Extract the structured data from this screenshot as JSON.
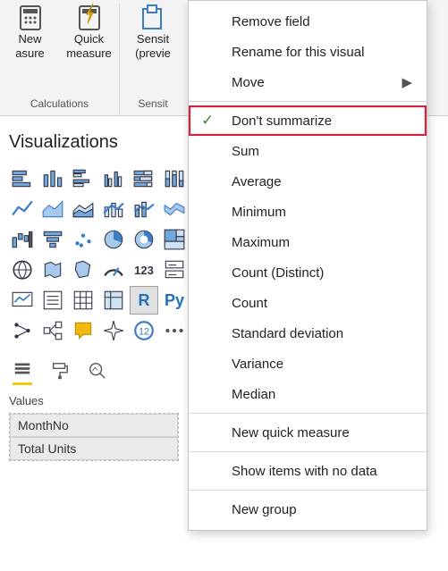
{
  "ribbon": {
    "group1_label": "Calculations",
    "group2_label": "Sensit",
    "btn_new_measure_l1": "New",
    "btn_new_measure_l2": "asure",
    "btn_quick_measure_l1": "Quick",
    "btn_quick_measure_l2": "measure",
    "btn_sensit_l1": "Sensit",
    "btn_sensit_l2": "(previe"
  },
  "viz": {
    "title": "Visualizations",
    "r_label": "R",
    "py_label": "Py",
    "values_label": "Values",
    "field1": "MonthNo",
    "field2": "Total Units"
  },
  "menu": {
    "remove_field": "Remove field",
    "rename": "Rename for this visual",
    "move": "Move",
    "dont_summarize": "Don't summarize",
    "sum": "Sum",
    "average": "Average",
    "minimum": "Minimum",
    "maximum": "Maximum",
    "count_distinct": "Count (Distinct)",
    "count": "Count",
    "std_dev": "Standard deviation",
    "variance": "Variance",
    "median": "Median",
    "new_quick": "New quick measure",
    "show_no_data": "Show items with no data",
    "new_group": "New group"
  }
}
